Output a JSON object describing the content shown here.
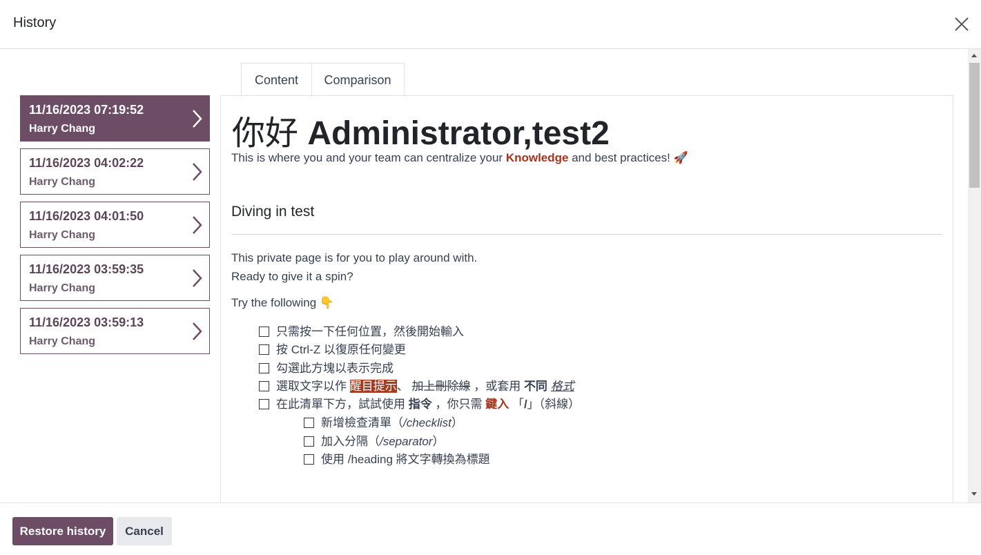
{
  "dialog": {
    "title": "History",
    "close_icon": "close-icon"
  },
  "versions": [
    {
      "date": "11/16/2023 07:19:52",
      "author": "Harry Chang",
      "active": true
    },
    {
      "date": "11/16/2023 04:02:22",
      "author": "Harry Chang",
      "active": false
    },
    {
      "date": "11/16/2023 04:01:50",
      "author": "Harry Chang",
      "active": false
    },
    {
      "date": "11/16/2023 03:59:35",
      "author": "Harry Chang",
      "active": false
    },
    {
      "date": "11/16/2023 03:59:13",
      "author": "Harry Chang",
      "active": false
    }
  ],
  "tabs": {
    "content": "Content",
    "comparison": "Comparison"
  },
  "article": {
    "h1_cjk": "你好",
    "h1_name": "Administrator,test2",
    "intro_before": "This is where you and your team can centralize your",
    "intro_keyword": "Knowledge",
    "intro_after": "and best practices!",
    "intro_emoji": "🚀",
    "h2": "Diving in test",
    "p1": "This private page is for you to play around with.",
    "p2": "Ready to give it a spin?",
    "p3": "Try the following",
    "p3_emoji": "👇",
    "checks": {
      "c1": "只需按一下任何位置，然後開始輸入",
      "c2": "按 Ctrl-Z 以復原任何變更",
      "c3": "勾選此方塊以表示完成",
      "c4_a": "選取文字以作",
      "c4_hl": "醒目提示",
      "c4_b": "、",
      "c4_strike": "加上刪除線",
      "c4_c": "，或套用",
      "c4_bold": "不同",
      "c4_ital": "格式",
      "c5_a": "在此清單下方，試試使用",
      "c5_bold": "指令",
      "c5_b": "，你只需",
      "c5_red": "鍵入",
      "c5_c": "「",
      "c5_slash": "/",
      "c5_d": "」（斜線）",
      "s1_a": "新增檢查清單（",
      "s1_i": "/checklist",
      "s1_b": "）",
      "s2_a": "加入分隔（",
      "s2_i": "/separator",
      "s2_b": "）",
      "s3": "使用 /heading 將文字轉換為標題"
    }
  },
  "footer": {
    "restore": "Restore history",
    "cancel": "Cancel"
  },
  "colors": {
    "accent": "#6d4c66",
    "highlight": "#a63a1e",
    "keyword": "#a3341d"
  }
}
